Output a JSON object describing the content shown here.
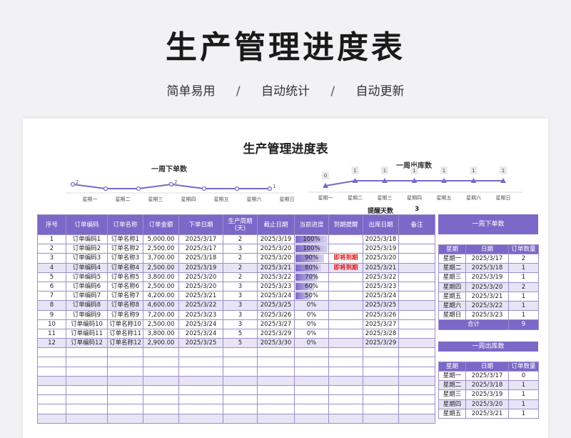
{
  "header": {
    "title": "生产管理进度表",
    "tags": [
      "简单易用",
      "自动统计",
      "自动更新"
    ],
    "separator": "/"
  },
  "sheet": {
    "title": "生产管理进度表",
    "remind_label": "提醒天数",
    "remind_value": "3"
  },
  "colors": {
    "accent": "#7b68c8",
    "alt_row": "#e8e4f6",
    "warn": "#e0161c"
  },
  "chart_data": [
    {
      "type": "line",
      "title": "一周下单数",
      "categories": [
        "星期一",
        "星期二",
        "星期三",
        "星期四",
        "星期五",
        "星期六",
        "星期日"
      ],
      "values": [
        2,
        1,
        1,
        2,
        1,
        1,
        1
      ],
      "label_flags": [
        true,
        false,
        false,
        true,
        false,
        false,
        true
      ],
      "ylim": [
        0,
        3
      ]
    },
    {
      "type": "line",
      "title": "一周出库数",
      "categories": [
        "星期一",
        "星期二",
        "星期三",
        "星期四",
        "星期五",
        "星期六",
        "星期日"
      ],
      "values": [
        0,
        1,
        1,
        1,
        1,
        1,
        1
      ],
      "ylim": [
        0,
        1
      ]
    }
  ],
  "main_table": {
    "headers": [
      "序号",
      "订单编码",
      "订单名称",
      "订单金额",
      "下单日期",
      "生产周期(天)",
      "截止日期",
      "当前进度",
      "到期提醒",
      "出库日期",
      "备注"
    ],
    "rows": [
      {
        "no": "1",
        "code": "订单编码1",
        "name": "订单名称1",
        "amount": "5,000.00",
        "order_date": "2025/3/17",
        "cycle": "2",
        "due": "2025/3/19",
        "progress": "100%",
        "progress_value": 100,
        "remind": "",
        "out_date": "2025/3/18",
        "note": ""
      },
      {
        "no": "2",
        "code": "订单编码2",
        "name": "订单名称2",
        "amount": "2,500.00",
        "order_date": "2025/3/17",
        "cycle": "3",
        "due": "2025/3/20",
        "progress": "100%",
        "progress_value": 100,
        "remind": "",
        "out_date": "2025/3/19",
        "note": ""
      },
      {
        "no": "3",
        "code": "订单编码3",
        "name": "订单名称3",
        "amount": "3,700.00",
        "order_date": "2025/3/18",
        "cycle": "2",
        "due": "2025/3/20",
        "progress": "90%",
        "progress_value": 90,
        "remind": "即将到期",
        "out_date": "2025/3/20",
        "note": ""
      },
      {
        "no": "4",
        "code": "订单编码4",
        "name": "订单名称4",
        "amount": "2,500.00",
        "order_date": "2025/3/19",
        "cycle": "2",
        "due": "2025/3/21",
        "progress": "80%",
        "progress_value": 80,
        "remind": "即将到期",
        "out_date": "2025/3/21",
        "note": ""
      },
      {
        "no": "5",
        "code": "订单编码5",
        "name": "订单名称5",
        "amount": "3,800.00",
        "order_date": "2025/3/20",
        "cycle": "2",
        "due": "2025/3/22",
        "progress": "70%",
        "progress_value": 70,
        "remind": "",
        "out_date": "2025/3/22",
        "note": ""
      },
      {
        "no": "6",
        "code": "订单编码6",
        "name": "订单名称6",
        "amount": "2,500.00",
        "order_date": "2025/3/20",
        "cycle": "3",
        "due": "2025/3/23",
        "progress": "60%",
        "progress_value": 60,
        "remind": "",
        "out_date": "2025/3/23",
        "note": ""
      },
      {
        "no": "7",
        "code": "订单编码7",
        "name": "订单名称7",
        "amount": "4,200.00",
        "order_date": "2025/3/21",
        "cycle": "3",
        "due": "2025/3/24",
        "progress": "50%",
        "progress_value": 50,
        "remind": "",
        "out_date": "2025/3/24",
        "note": ""
      },
      {
        "no": "8",
        "code": "订单编码8",
        "name": "订单名称8",
        "amount": "4,600.00",
        "order_date": "2025/3/22",
        "cycle": "3",
        "due": "2025/3/25",
        "progress": "0%",
        "progress_value": 0,
        "remind": "",
        "out_date": "2025/3/25",
        "note": ""
      },
      {
        "no": "9",
        "code": "订单编码9",
        "name": "订单名称9",
        "amount": "7,200.00",
        "order_date": "2025/3/23",
        "cycle": "3",
        "due": "2025/3/26",
        "progress": "0%",
        "progress_value": 0,
        "remind": "",
        "out_date": "2025/3/26",
        "note": ""
      },
      {
        "no": "10",
        "code": "订单编码10",
        "name": "订单名称10",
        "amount": "2,500.00",
        "order_date": "2025/3/24",
        "cycle": "3",
        "due": "2025/3/27",
        "progress": "0%",
        "progress_value": 0,
        "remind": "",
        "out_date": "2025/3/27",
        "note": ""
      },
      {
        "no": "11",
        "code": "订单编码11",
        "name": "订单名称11",
        "amount": "3,800.00",
        "order_date": "2025/3/24",
        "cycle": "5",
        "due": "2025/3/29",
        "progress": "0%",
        "progress_value": 0,
        "remind": "",
        "out_date": "2025/3/28",
        "note": ""
      },
      {
        "no": "12",
        "code": "订单编码12",
        "name": "订单名称12",
        "amount": "2,900.00",
        "order_date": "2025/3/25",
        "cycle": "5",
        "due": "2025/3/30",
        "progress": "0%",
        "progress_value": 0,
        "remind": "",
        "out_date": "2025/3/29",
        "note": ""
      }
    ]
  },
  "order_summary": {
    "title": "一周下单数",
    "headers": [
      "星期",
      "日期",
      "订单数量"
    ],
    "rows": [
      [
        "星期一",
        "2025/3/17",
        "2"
      ],
      [
        "星期二",
        "2025/3/18",
        "1"
      ],
      [
        "星期三",
        "2025/3/19",
        "1"
      ],
      [
        "星期四",
        "2025/3/20",
        "2"
      ],
      [
        "星期五",
        "2025/3/21",
        "1"
      ],
      [
        "星期六",
        "2025/3/22",
        "1"
      ],
      [
        "星期日",
        "2025/3/23",
        "1"
      ]
    ],
    "total_label": "合计",
    "total_value": "9"
  },
  "outbound_summary": {
    "title": "一周出库数",
    "headers": [
      "星期",
      "日期",
      "订单数量"
    ],
    "rows": [
      [
        "星期一",
        "2025/3/17",
        "0"
      ],
      [
        "星期二",
        "2025/3/18",
        "1"
      ],
      [
        "星期三",
        "2025/3/19",
        "1"
      ],
      [
        "星期四",
        "2025/3/20",
        "1"
      ],
      [
        "星期五",
        "2025/3/21",
        "1"
      ]
    ]
  }
}
